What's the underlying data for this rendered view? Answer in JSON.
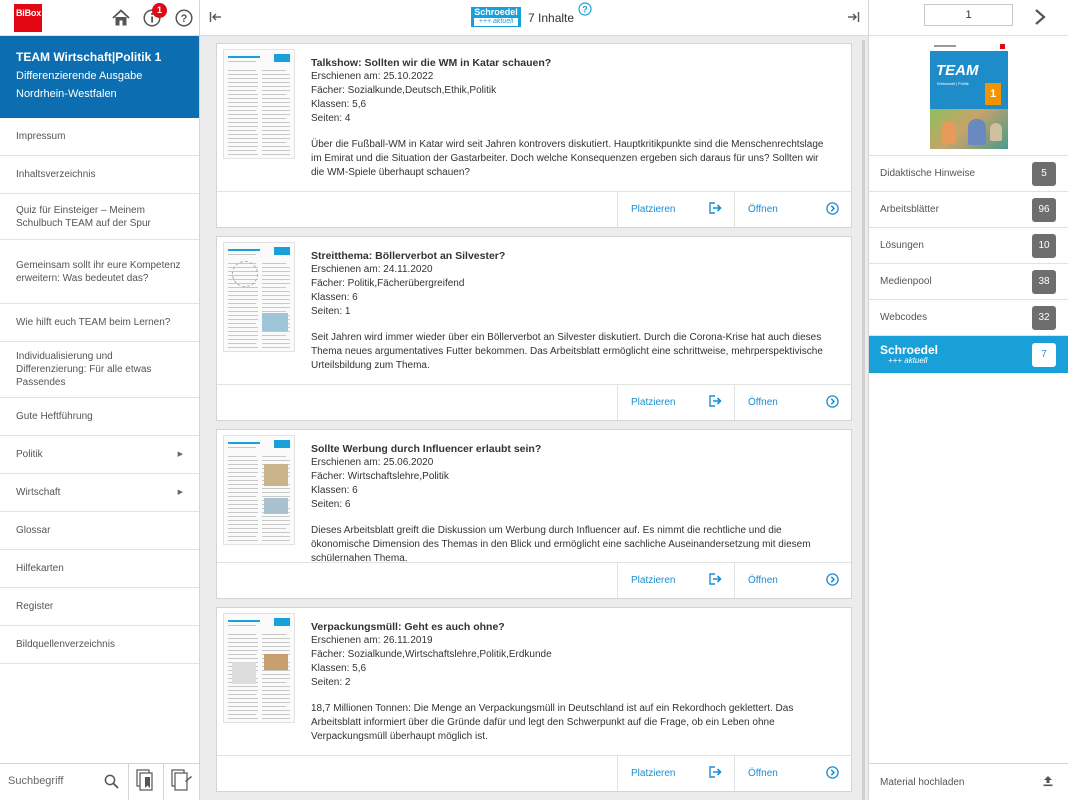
{
  "app": {
    "logo_text": "BiBox",
    "notification_count": "1"
  },
  "book": {
    "title": "TEAM Wirtschaft|Politik 1",
    "edition": "Differenzierende Ausgabe",
    "region": "Nordrhein-Westfalen"
  },
  "toc": [
    {
      "label": "Impressum",
      "has_children": false
    },
    {
      "label": "Inhaltsverzeichnis",
      "has_children": false
    },
    {
      "label": "Quiz für Einsteiger – Meinem Schulbuch TEAM auf der Spur",
      "has_children": false
    },
    {
      "label": "Gemeinsam sollt ihr eure Kompetenz erweitern: Was bedeutet das?",
      "has_children": false
    },
    {
      "label": "Wie hilft euch TEAM beim Lernen?",
      "has_children": false
    },
    {
      "label": "Individualisierung und Differenzierung: Für alle etwas Passendes",
      "has_children": false
    },
    {
      "label": "Gute Heftführung",
      "has_children": false
    },
    {
      "label": "Politik",
      "has_children": true
    },
    {
      "label": "Wirtschaft",
      "has_children": true
    },
    {
      "label": "Glossar",
      "has_children": false
    },
    {
      "label": "Hilfekarten",
      "has_children": false
    },
    {
      "label": "Register",
      "has_children": false
    },
    {
      "label": "Bildquellenverzeichnis",
      "has_children": false
    }
  ],
  "search": {
    "placeholder": "Suchbegriff"
  },
  "center": {
    "logo_top": "Schroedel",
    "logo_bottom": "+++ aktuell",
    "count_label": "7 Inhalte"
  },
  "cards": [
    {
      "title": "Talkshow: Sollten wir die WM in Katar schauen?",
      "date": "Erschienen am: 25.10.2022",
      "subjects": "Fächer: Sozialkunde,Deutsch,Ethik,Politik",
      "classes": "Klassen: 5,6",
      "pages": "Seiten: 4",
      "description": "Über die Fußball-WM in Katar wird seit Jahren kontrovers diskutiert. Hauptkritikpunkte sind die Menschenrechtslage im Emirat und die Situation der Gastarbeiter. Doch welche Konsequenzen ergeben sich daraus für uns? Sollten wir die WM-Spiele überhaupt schauen?",
      "place_label": "Platzieren",
      "open_label": "Öffnen"
    },
    {
      "title": "Streitthema: Böllerverbot an Silvester?",
      "date": "Erschienen am: 24.11.2020",
      "subjects": "Fächer: Politik,Fächerübergreifend",
      "classes": "Klassen: 6",
      "pages": "Seiten: 1",
      "description": "Seit Jahren wird immer wieder über ein Böllerverbot an Silvester diskutiert. Durch die Corona-Krise hat auch dieses Thema neues argumentatives Futter bekommen. Das Arbeitsblatt ermöglicht eine schrittweise, mehrperspektivische Urteilsbildung zum Thema.",
      "place_label": "Platzieren",
      "open_label": "Öffnen"
    },
    {
      "title": "Sollte Werbung durch Influencer erlaubt sein?",
      "date": "Erschienen am: 25.06.2020",
      "subjects": "Fächer: Wirtschaftslehre,Politik",
      "classes": "Klassen: 6",
      "pages": "Seiten: 6",
      "description": "Dieses Arbeitsblatt greift die Diskussion um Werbung durch Influencer auf. Es nimmt die rechtliche und die ökonomische Dimension des Themas in den Blick und ermöglicht eine sachliche Auseinandersetzung mit diesem schülernahen Thema.",
      "place_label": "Platzieren",
      "open_label": "Öffnen"
    },
    {
      "title": "Verpackungsmüll: Geht es auch ohne?",
      "date": "Erschienen am: 26.11.2019",
      "subjects": "Fächer: Sozialkunde,Wirtschaftslehre,Politik,Erdkunde",
      "classes": "Klassen: 5,6",
      "pages": "Seiten: 2",
      "description": "18,7 Millionen Tonnen: Die Menge an Verpackungsmüll in Deutschland ist auf ein Rekordhoch geklettert. Das Arbeitsblatt informiert über die Gründe dafür und legt den Schwerpunkt auf die Frage, ob ein Leben ohne Verpackungsmüll überhaupt möglich ist.",
      "place_label": "Platzieren",
      "open_label": "Öffnen"
    }
  ],
  "right": {
    "page_number": "1",
    "cover": {
      "title": "TEAM",
      "subtitle": "Wirtschaft | Politik",
      "volume": "1"
    },
    "categories": [
      {
        "label": "Didaktische Hinweise",
        "count": "5",
        "active": false
      },
      {
        "label": "Arbeitsblätter",
        "count": "96",
        "active": false
      },
      {
        "label": "Lösungen",
        "count": "10",
        "active": false
      },
      {
        "label": "Medienpool",
        "count": "38",
        "active": false
      },
      {
        "label": "Webcodes",
        "count": "32",
        "active": false
      },
      {
        "label_top": "Schroedel",
        "label_bottom": "+++ aktuell",
        "count": "7",
        "active": true
      }
    ],
    "upload_label": "Material hochladen"
  },
  "colors": {
    "brand_blue": "#0c6eb0",
    "accent_blue": "#1aa0d8",
    "red": "#e30613",
    "count_grey": "#6e6e6e"
  }
}
